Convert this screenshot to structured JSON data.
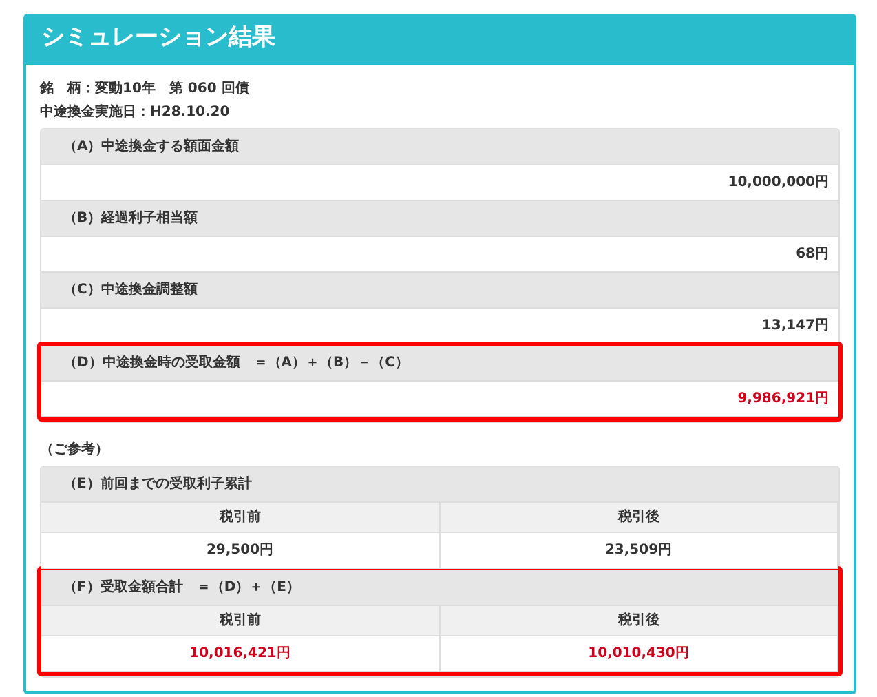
{
  "panel": {
    "title": "シミュレーション結果"
  },
  "info": [
    "銘　柄：変動10年　第 060 回債",
    "中途換金実施日：H28.10.20"
  ],
  "sections": [
    {
      "kind": "single",
      "label": "（A）中途換金する額面金額",
      "value": "10,000,000円",
      "highlighted": false
    },
    {
      "kind": "single",
      "label": "（B）経過利子相当額",
      "value": "68円",
      "highlighted": false
    },
    {
      "kind": "single",
      "label": "（C）中途換金調整額",
      "value": "13,147円",
      "highlighted": false
    },
    {
      "kind": "single",
      "label": "（D）中途換金時の受取金額　＝（A）＋（B）－（C）",
      "value": "9,986,921円",
      "highlighted": true
    }
  ],
  "note": "（ご参考）",
  "reference": [
    {
      "kind": "split",
      "label": "（E）前回までの受取利子累計",
      "columns": [
        "税引前",
        "税引後"
      ],
      "values": [
        "29,500円",
        "23,509円"
      ],
      "highlighted": false
    },
    {
      "kind": "split",
      "label": "（F）受取金額合計　＝（D）＋（E）",
      "columns": [
        "税引前",
        "税引後"
      ],
      "values": [
        "10,016,421円",
        "10,010,430円"
      ],
      "highlighted": true
    }
  ]
}
